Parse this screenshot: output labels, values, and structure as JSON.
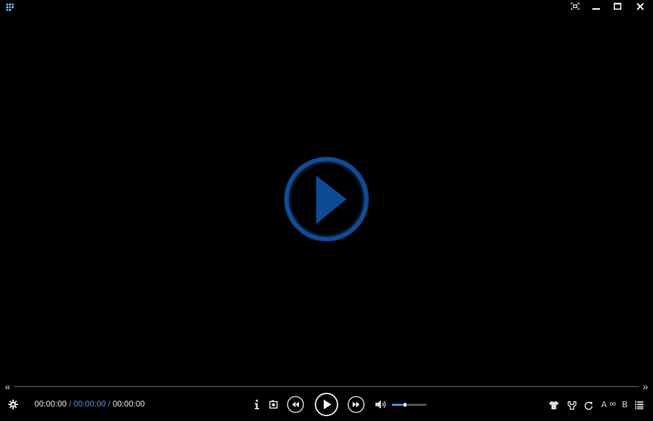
{
  "window": {
    "controls": [
      "fullscreen-toggle",
      "minimize",
      "maximize",
      "close"
    ]
  },
  "playback": {
    "current_time": "00:00:00",
    "separator": "/",
    "middle_time": "00:00:00",
    "total_time": "00:00:00",
    "state": "paused"
  },
  "volume": {
    "level": 0.38
  },
  "ab_repeat": {
    "a_label": "A",
    "loop_label": "∞",
    "b_label": "B"
  },
  "colors": {
    "accent": "#4a8fe0",
    "big_play": "#0f3f7e",
    "background": "#000000"
  },
  "icons": {
    "app": "app-grid-icon",
    "settings": "gear-icon",
    "info": "info-icon",
    "screenshot": "camera-icon",
    "prev": "rewind-icon",
    "play": "play-icon",
    "next": "fast-forward-icon",
    "volume": "speaker-icon",
    "skin": "shirt-icon",
    "subtitle": "subtitle-icon",
    "rotate": "rotate-icon",
    "playlist": "playlist-icon"
  }
}
